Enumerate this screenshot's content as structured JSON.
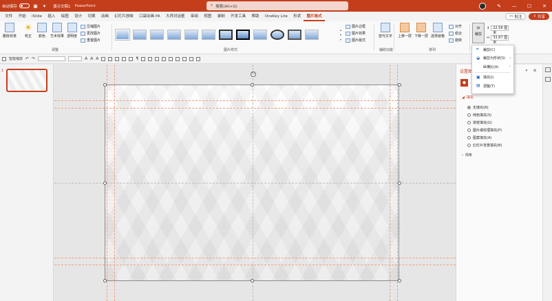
{
  "titlebar": {
    "autosave_label": "自动保存",
    "doc_title": "演示文稿1",
    "app_name": "PowerPoint",
    "search_placeholder": "搜索(Alt+Q)"
  },
  "tabs": [
    {
      "label": "文件"
    },
    {
      "label": "开始"
    },
    {
      "label": "iSlide"
    },
    {
      "label": "插入"
    },
    {
      "label": "绘图"
    },
    {
      "label": "设计"
    },
    {
      "label": "切换"
    },
    {
      "label": "动画"
    },
    {
      "label": "幻灯片放映"
    },
    {
      "label": "口袋动画 PA"
    },
    {
      "label": "大师对话框"
    },
    {
      "label": "审阅"
    },
    {
      "label": "视图"
    },
    {
      "label": "录制"
    },
    {
      "label": "开发工具"
    },
    {
      "label": "帮助"
    },
    {
      "label": "OneKey Lite"
    },
    {
      "label": "形状"
    },
    {
      "label": "图片格式",
      "active": true
    }
  ],
  "tabs_right": {
    "comment": "批注",
    "share": "共享"
  },
  "ribbon": {
    "remove_bg": "删除背景",
    "corrections": "校正",
    "color": "颜色",
    "artistic": "艺术效果",
    "transparency": "透明度",
    "compress": "压缩图片",
    "change": "更改图片",
    "reset": "重置图片",
    "adjust_group": "调整",
    "styles_group": "图片样式",
    "border": "图片边框",
    "effects": "图片效果",
    "layout": "图片版式",
    "accessibility": "替代文字",
    "accessibility_group": "辅助功能",
    "bring_forward": "上移一层",
    "send_backward": "下移一层",
    "selection_pane": "选择窗格",
    "align": "对齐",
    "group": "组合",
    "rotate": "旋转",
    "arrange_group": "排列",
    "crop": "裁剪",
    "height_value": "22.58 厘米",
    "width_value": "33.87 厘米",
    "size_group": "大小"
  },
  "crop_menu": {
    "items": [
      {
        "label": "裁剪(C)",
        "icon": "crop-icon"
      },
      {
        "label": "裁剪为形状(S)",
        "icon": "shape-icon",
        "submenu": true
      },
      {
        "label": "纵横比(A)",
        "icon": "",
        "submenu": true
      },
      {
        "label": "填充(I)",
        "icon": "fill-icon"
      },
      {
        "label": "调整(T)",
        "icon": "fit-icon"
      }
    ]
  },
  "qat": {
    "autofit": "智能缩放"
  },
  "thumbnails": {
    "slide_number": "1"
  },
  "format_pane": {
    "title": "设置图片格式",
    "fill_section": "填充",
    "options": [
      {
        "label": "无填充(N)",
        "selected": true
      },
      {
        "label": "纯色填充(S)",
        "selected": false
      },
      {
        "label": "渐变填充(G)",
        "selected": false
      },
      {
        "label": "图片或纹理填充(P)",
        "selected": false
      },
      {
        "label": "图案填充(A)",
        "selected": false
      },
      {
        "label": "幻灯片背景填充(B)",
        "selected": false
      }
    ],
    "line_section": "线条"
  }
}
